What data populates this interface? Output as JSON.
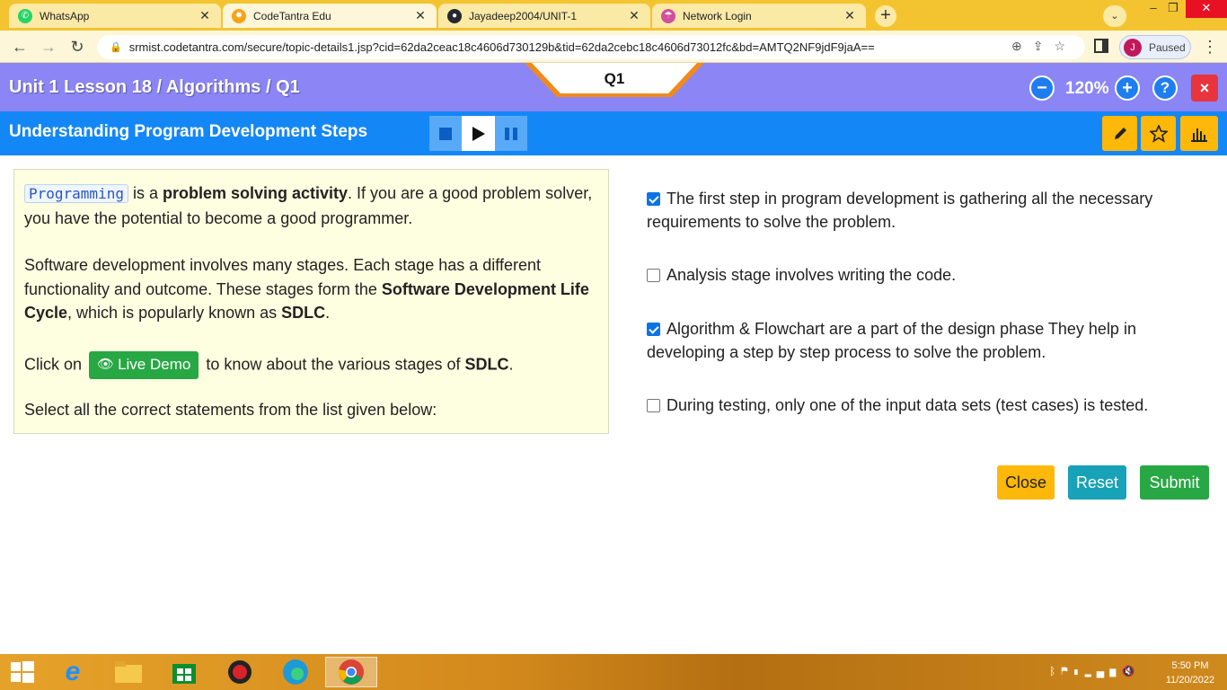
{
  "browser": {
    "tabs": [
      {
        "label": "WhatsApp",
        "icon": "whatsapp-icon"
      },
      {
        "label": "CodeTantra Edu",
        "icon": "codetantra-icon"
      },
      {
        "label": "Jayadeep2004/UNIT-1",
        "icon": "github-icon"
      },
      {
        "label": "Network Login",
        "icon": "network-login-icon"
      }
    ],
    "url": "srmist.codetantra.com/secure/topic-details1.jsp?cid=62da2ceac18c4606d730129b&tid=62da2cebc18c4606d73012fc&bd=AMTQ2NF9jdF9jaA==",
    "profile_initial": "J",
    "profile_status": "Paused"
  },
  "header": {
    "breadcrumb": "Unit 1 Lesson 18 / Algorithms / Q1",
    "question_label": "Q1",
    "zoom": "120%",
    "help": "?",
    "close": "×"
  },
  "subheader": {
    "title": "Understanding Program Development Steps"
  },
  "content": {
    "p1_code": "Programming",
    "p1_a": " is a ",
    "p1_bold": "problem solving activity",
    "p1_b": ". If you are a good problem solver, you have the potential to become a good programmer.",
    "p2_a": "Software development involves many stages. Each stage has a different functionality and outcome. These stages form the ",
    "p2_bold1": "Software Development Life Cycle",
    "p2_b": ", which is popularly known as ",
    "p2_bold2": "SDLC",
    "p2_c": ".",
    "p3_a": "Click on ",
    "demo_label": "Live Demo",
    "p3_b": " to know about the various stages of ",
    "p3_bold": "SDLC",
    "p3_c": ".",
    "p4": "Select all the correct statements from the list given below:"
  },
  "options": [
    {
      "text": "The first step in program development is gathering all the necessary requirements to solve the problem.",
      "checked": true
    },
    {
      "text": "Analysis stage involves writing the code.",
      "checked": false
    },
    {
      "text": "Algorithm & Flowchart are a part of the design phase They help in developing a step by step process to solve the problem.",
      "checked": true
    },
    {
      "text": "During testing, only one of the input data sets (test cases) is tested.",
      "checked": false
    }
  ],
  "actions": {
    "close": "Close",
    "reset": "Reset",
    "submit": "Submit"
  },
  "taskbar": {
    "time": "5:50 PM",
    "date": "11/20/2022"
  },
  "colors": {
    "header_bg": "#8b85f5",
    "subheader_bg": "#1487f7",
    "panel_bg": "#fefee0",
    "close_btn": "#fdb80a",
    "reset_btn": "#17a2b8",
    "submit_btn": "#28a745",
    "taskbar": "#d48a1c"
  }
}
